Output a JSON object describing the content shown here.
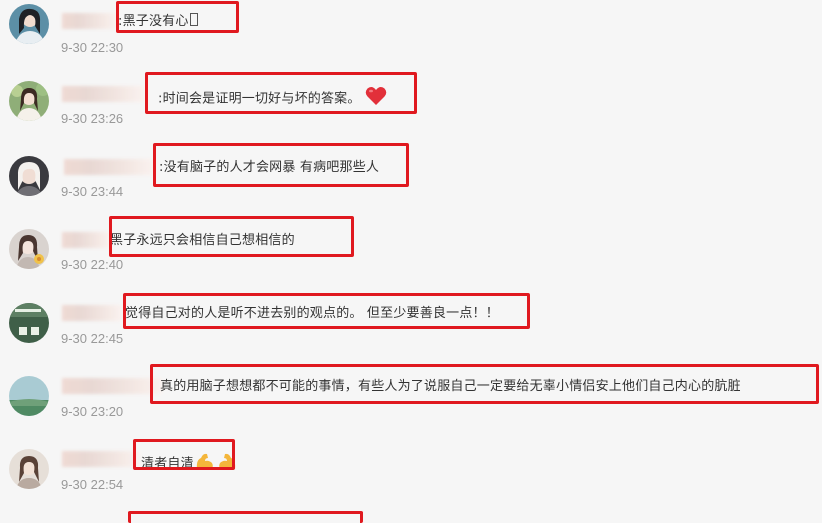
{
  "comments": [
    {
      "text": ":黑子没有心",
      "time": "9-30 22:30",
      "avatar_icon": "avatar-girl-teal-icon"
    },
    {
      "text": ":时间会是证明一切好与坏的答案。",
      "time": "9-30 23:26",
      "emoji": "red-heart-icon",
      "avatar_icon": "avatar-girl-garden-icon"
    },
    {
      "text": ":没有脑子的人才会网暴 有病吧那些人",
      "time": "9-30 23:44",
      "avatar_icon": "avatar-girl-dark-icon"
    },
    {
      "text": "黑子永远只会相信自己想相信的",
      "time": "9-30 22:40",
      "avatar_icon": "avatar-girl-flower-icon"
    },
    {
      "text": "觉得自己对的人是听不进去别的观点的。 但至少要善良一点！！",
      "time": "9-30 22:45",
      "avatar_icon": "avatar-green-text-icon"
    },
    {
      "text": "真的用脑子想想都不可能的事情，有些人为了说服自己一定要给无辜小情侣安上他们自己内心的肮脏",
      "time": "9-30 23:20",
      "avatar_icon": "avatar-landscape-icon"
    },
    {
      "text": "清者自清",
      "time": "9-30 22:54",
      "emoji": "flexed-biceps-icon",
      "avatar_icon": "avatar-girl-light-icon"
    }
  ],
  "colors": {
    "highlight_box": "#e0191f",
    "background": "#f6f6f6",
    "time_text": "#999999",
    "comment_text": "#333333"
  }
}
